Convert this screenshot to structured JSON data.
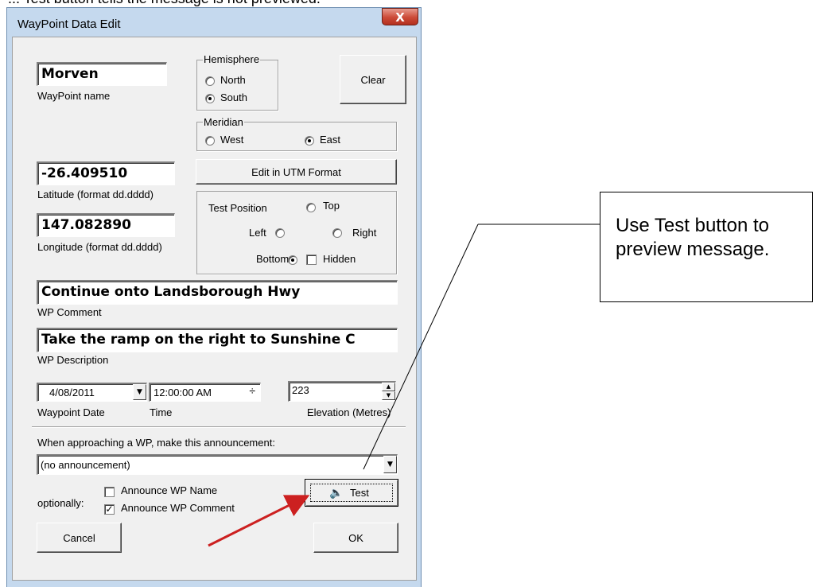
{
  "page_header_text": "... Test button tells the message is not previewed.",
  "window": {
    "title": "WayPoint Data Edit",
    "close_glyph": "X"
  },
  "waypoint": {
    "name_value": "Morven",
    "name_label": "WayPoint name"
  },
  "hemisphere": {
    "legend": "Hemisphere",
    "north": "North",
    "south": "South",
    "selected": "South"
  },
  "clear_button": "Clear",
  "meridian": {
    "legend": "Meridian",
    "west": "West",
    "east": "East",
    "selected": "East"
  },
  "utm_button": "Edit in UTM Format",
  "latitude": {
    "value": "-26.409510",
    "label": "Latitude (format dd.dddd)"
  },
  "longitude": {
    "value": "147.082890",
    "label": "Longitude (format dd.dddd)"
  },
  "test_position": {
    "title": "Test Position",
    "top": "Top",
    "left": "Left",
    "right": "Right",
    "bottom": "Bottom",
    "hidden": "Hidden",
    "selected": "Bottom",
    "hidden_checked": false
  },
  "comment": {
    "value": "Continue onto Landsborough Hwy",
    "label": "WP Comment"
  },
  "description": {
    "value": "Take the ramp on the right to Sunshine C",
    "label": "WP Description"
  },
  "date": {
    "value": "4/08/2011",
    "label": "Waypoint Date"
  },
  "time": {
    "value": "12:00:00 AM",
    "label": "Time"
  },
  "elevation": {
    "value": "223",
    "label": "Elevation (Metres)"
  },
  "announcement": {
    "label": "When approaching a WP, make this announcement:",
    "selected": "(no announcement)"
  },
  "optionally": {
    "label": "optionally:",
    "announce_name": "Announce WP Name",
    "announce_name_checked": false,
    "announce_comment": "Announce WP Comment",
    "announce_comment_checked": true
  },
  "test_button": "Test",
  "cancel_button": "Cancel",
  "ok_button": "OK",
  "callout": {
    "text": "Use Test button to preview message."
  },
  "colors": {
    "arrow": "#cc2020",
    "dialog_bg": "#f0f0f0",
    "frame": "#c5d9ee"
  }
}
